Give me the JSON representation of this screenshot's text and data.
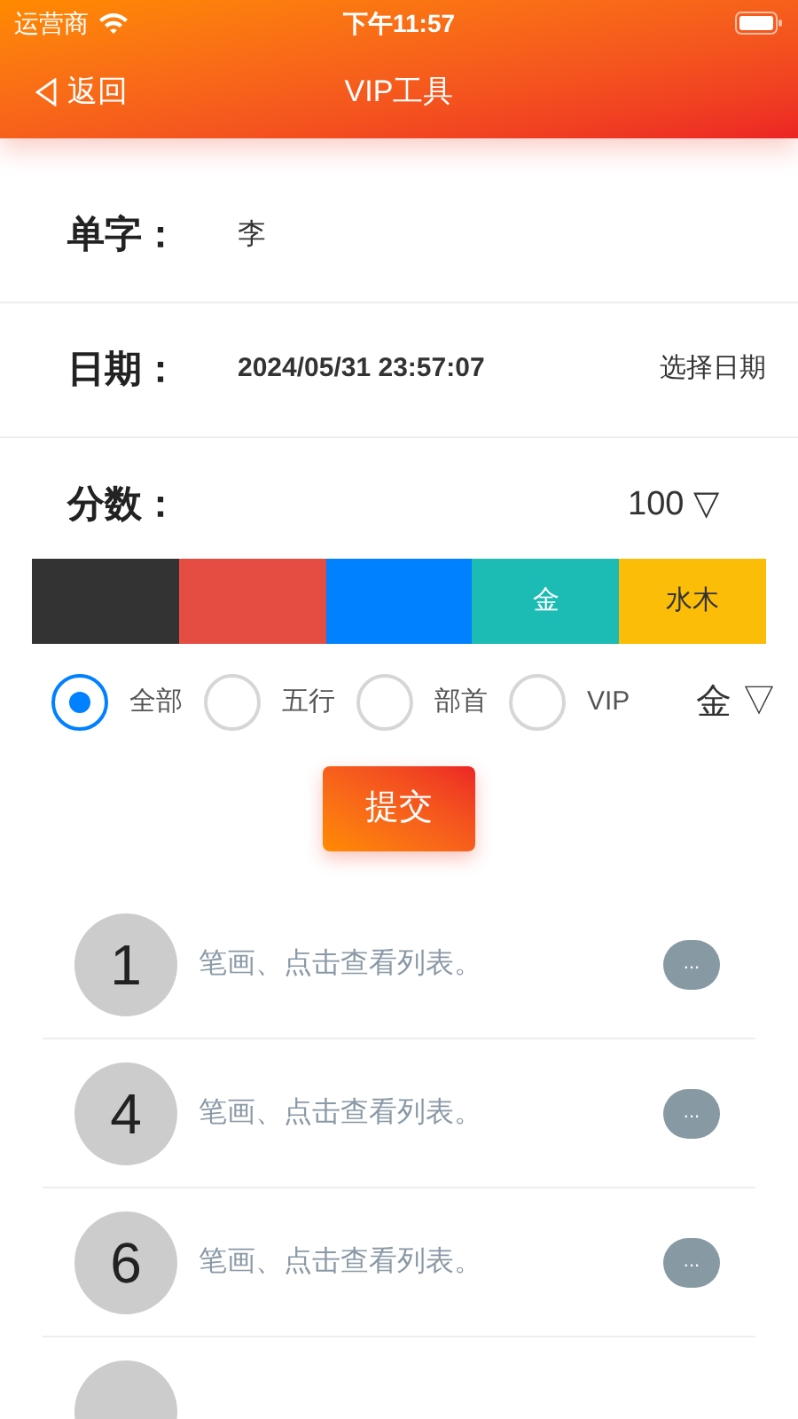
{
  "status_bar": {
    "carrier": "运营商",
    "time": "下午11:57"
  },
  "nav": {
    "back": "返回",
    "title": "VIP工具"
  },
  "fields": [
    {
      "label": "单字：",
      "value": "李"
    },
    {
      "label": "日期：",
      "value": "2024/05/31 23:57:07",
      "action": "选择日期"
    },
    {
      "label": "分数：",
      "dropdown": "100 ▽"
    }
  ],
  "color_bar": [
    {
      "color": "#333333"
    },
    {
      "color": "#e54d42"
    },
    {
      "color": "#0081ff"
    },
    {
      "color": "#1cbbb4",
      "label": "金"
    },
    {
      "color": "#fbbd08",
      "label": "水木"
    }
  ],
  "filters": [
    {
      "label": "全部",
      "selected": true
    },
    {
      "label": "五行",
      "selected": false
    },
    {
      "label": "部首",
      "selected": false
    },
    {
      "label": "VIP",
      "selected": false
    }
  ],
  "filter_dropdown": "金 ▽",
  "submit": "提交",
  "results": [
    {
      "kind": "row",
      "number": "1",
      "text": "笔画、点击查看列表。",
      "more": "..."
    },
    {
      "kind": "row",
      "number": "4",
      "text": "笔画、点击查看列表。",
      "more": "..."
    },
    {
      "kind": "row",
      "number": "6",
      "text": "笔画、点击查看列表。",
      "more": "..."
    },
    {
      "kind": "cut"
    }
  ]
}
